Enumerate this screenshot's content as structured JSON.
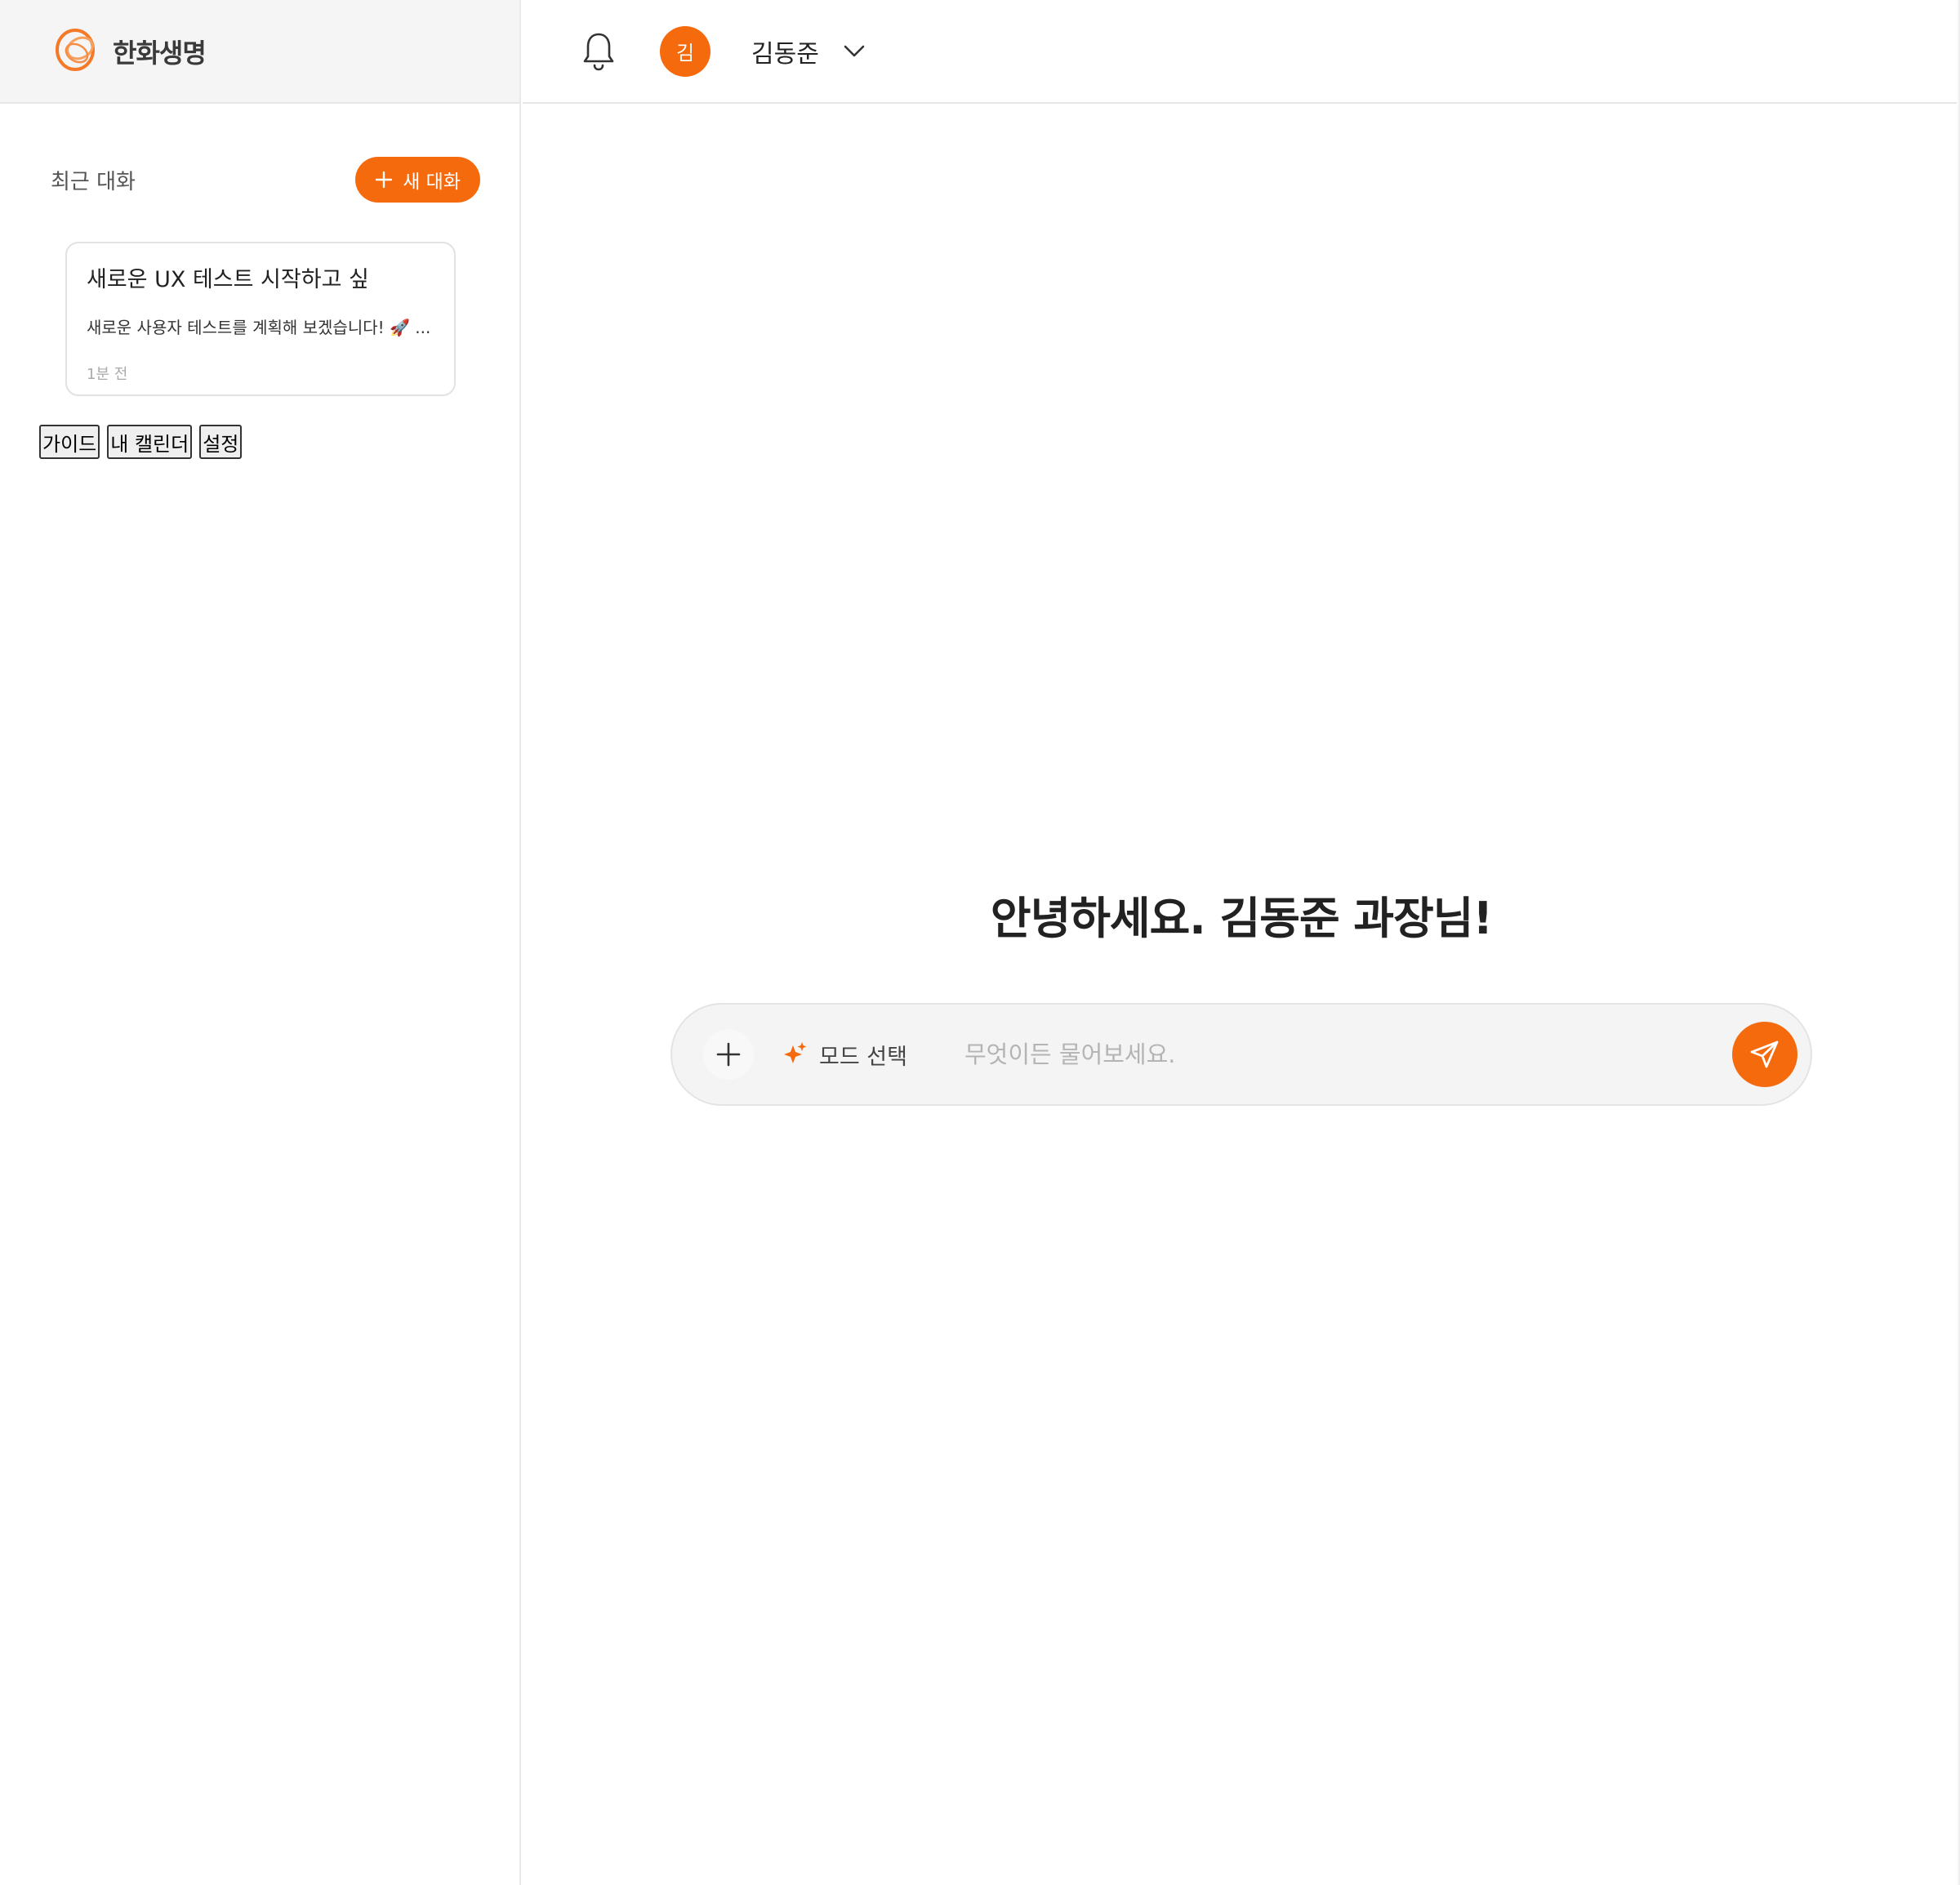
{
  "brand": {
    "logo_text": "한화생명",
    "accent_color": "#f46a0d"
  },
  "sidebar": {
    "recent_title": "최근 대화",
    "new_chat_label": "새 대화",
    "conversations": [
      {
        "title": "새로운 UX 테스트 시작하고 싶",
        "preview": "새로운 사용자 테스트를 계획해 보겠습니다! 🚀 ...",
        "time": "1분 전"
      }
    ],
    "links": [
      "가이드",
      "내 캘린더",
      "설정"
    ]
  },
  "topbar": {
    "avatar_initial": "김",
    "user_name": "김동준",
    "icons": [
      "bell-icon",
      "chevron-down-icon"
    ]
  },
  "main": {
    "greeting": "안녕하세요. 김동준 과장님!",
    "composer": {
      "mode_label": "모드 선택",
      "placeholder": "무엇이든 물어보세요."
    }
  }
}
